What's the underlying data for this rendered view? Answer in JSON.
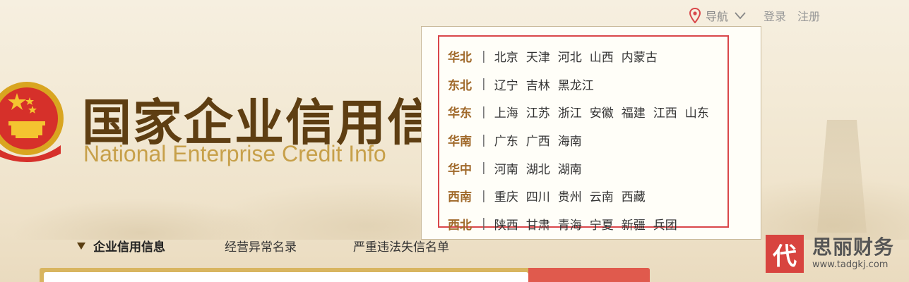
{
  "topnav": {
    "nav_label": "导航",
    "login": "登录",
    "register": "注册"
  },
  "header": {
    "title_cn": "国家企业信用信",
    "title_en": "National Enterprise Credit Info"
  },
  "regions": [
    {
      "name": "华北",
      "cities": [
        "北京",
        "天津",
        "河北",
        "山西",
        "内蒙古"
      ]
    },
    {
      "name": "东北",
      "cities": [
        "辽宁",
        "吉林",
        "黑龙江"
      ]
    },
    {
      "name": "华东",
      "cities": [
        "上海",
        "江苏",
        "浙江",
        "安徽",
        "福建",
        "江西",
        "山东"
      ]
    },
    {
      "name": "华南",
      "cities": [
        "广东",
        "广西",
        "海南"
      ]
    },
    {
      "name": "华中",
      "cities": [
        "河南",
        "湖北",
        "湖南"
      ]
    },
    {
      "name": "西南",
      "cities": [
        "重庆",
        "四川",
        "贵州",
        "云南",
        "西藏"
      ]
    },
    {
      "name": "西北",
      "cities": [
        "陕西",
        "甘肃",
        "青海",
        "宁夏",
        "新疆",
        "兵团"
      ]
    }
  ],
  "region_separator": "|",
  "tabs": {
    "active": "企业信用信息",
    "second": "经营异常名录",
    "third": "严重违法失信名单"
  },
  "watermark": {
    "logo_char": "代",
    "name": "思丽财务",
    "url": "www.tadgkj.com"
  },
  "colors": {
    "accent_red": "#d9474a",
    "title_brown": "#5e3e12",
    "region_gold": "#a0692a"
  }
}
